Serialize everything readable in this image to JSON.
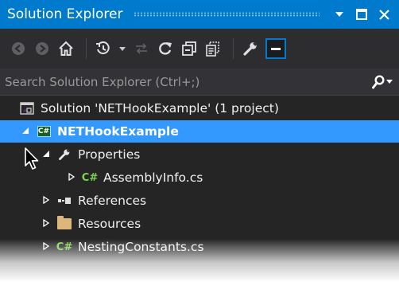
{
  "window": {
    "title": "Solution Explorer",
    "buttons": {
      "dropdown_glyph": "▼",
      "maximize_glyph": "□",
      "close_glyph": "✕"
    }
  },
  "toolbar": {
    "icons": [
      "back-icon",
      "forward-icon",
      "home-icon",
      "history-icon",
      "sync-icon",
      "refresh-icon",
      "collapse-all-icon",
      "show-all-files-icon",
      "properties-wrench-icon",
      "preview-icon"
    ]
  },
  "search": {
    "placeholder": "Search Solution Explorer (Ctrl+;)",
    "icon_glyph": "⚲"
  },
  "tree": {
    "solution_label": "Solution 'NETHookExample' (1 project)",
    "project_label": "NETHookExample",
    "properties_label": "Properties",
    "assemblyinfo_label": "AssemblyInfo.cs",
    "references_label": "References",
    "resources_label": "Resources",
    "nesting_label": "NestingConstants.cs"
  },
  "colors": {
    "title_bar": "#007acc",
    "selection": "#3399ff",
    "background": "#252526",
    "csharp_green": "#7fd44d"
  }
}
